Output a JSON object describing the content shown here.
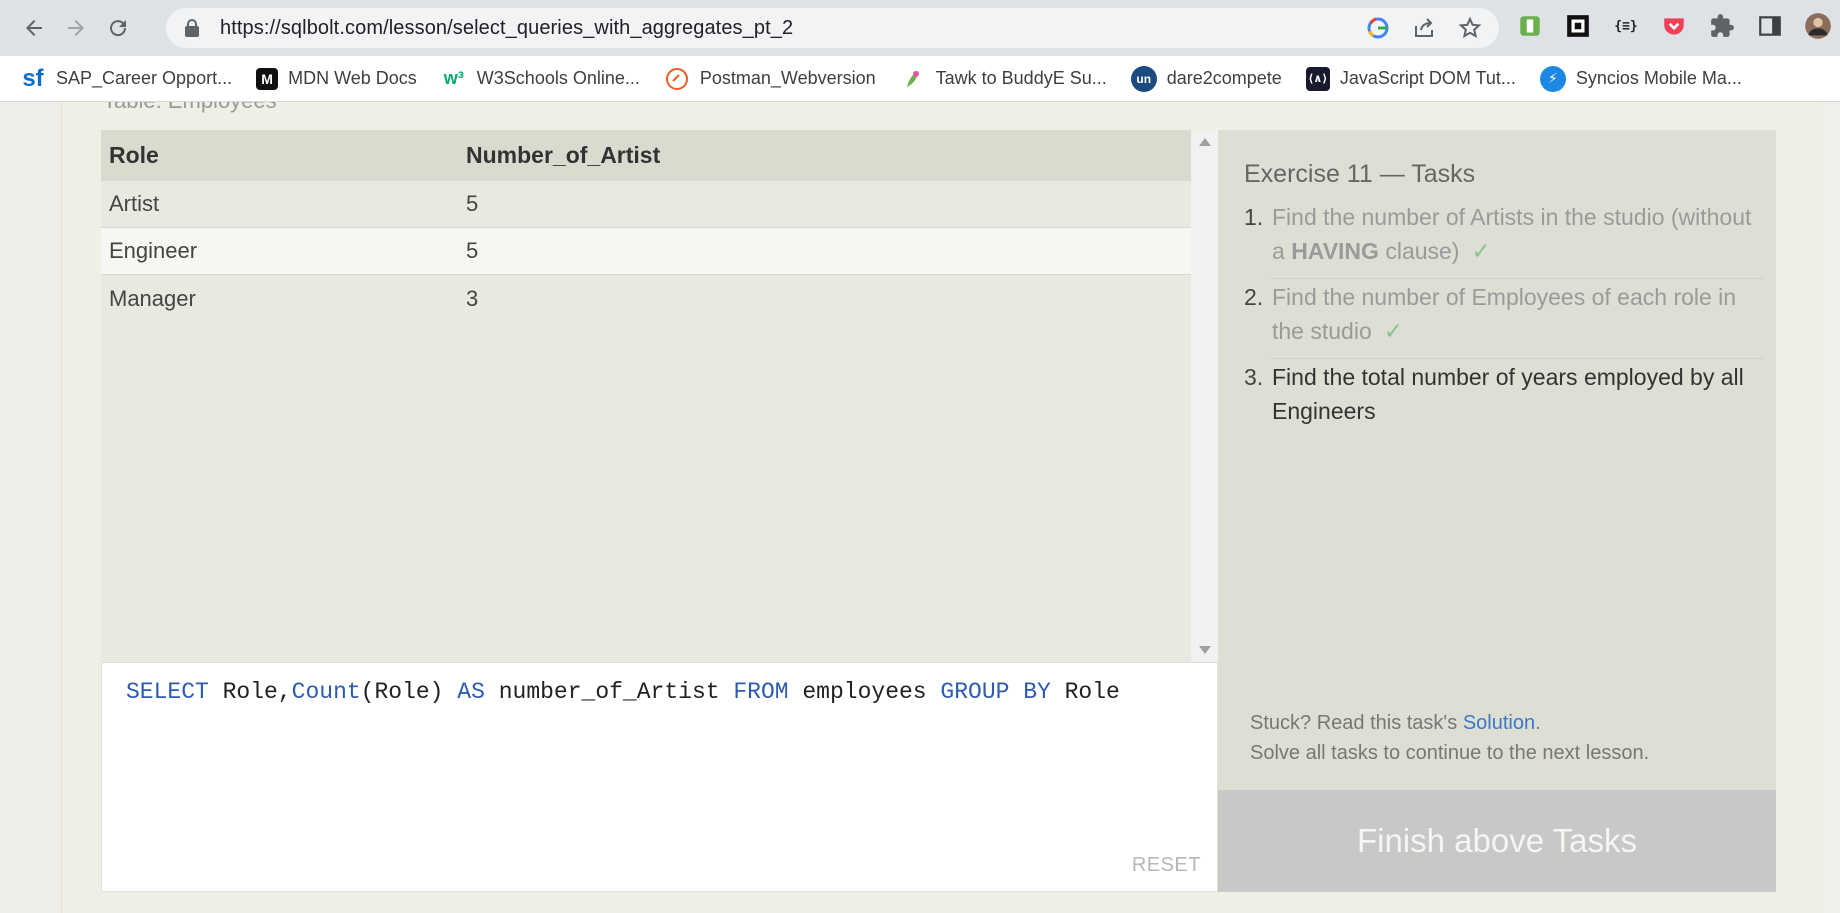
{
  "browser": {
    "url": "https://sqlbolt.com/lesson/select_queries_with_aggregates_pt_2",
    "bookmarks": [
      {
        "label": "SAP_Career Opport...",
        "icon": "sap-successfactors-icon"
      },
      {
        "label": "MDN Web Docs",
        "icon": "mdn-icon"
      },
      {
        "label": "W3Schools Online...",
        "icon": "w3schools-icon"
      },
      {
        "label": "Postman_Webversion",
        "icon": "postman-icon"
      },
      {
        "label": "Tawk to BuddyE Su...",
        "icon": "tawk-icon"
      },
      {
        "label": "dare2compete",
        "icon": "unstop-icon"
      },
      {
        "label": "JavaScript DOM Tut...",
        "icon": "javascript-dom-icon"
      },
      {
        "label": "Syncios Mobile Ma...",
        "icon": "syncios-icon"
      }
    ]
  },
  "lesson": {
    "table_label": "Table: Employees",
    "result_table": {
      "headers": [
        "Role",
        "Number_of_Artist"
      ],
      "rows": [
        [
          "Artist",
          "5"
        ],
        [
          "Engineer",
          "5"
        ],
        [
          "Manager",
          "3"
        ]
      ]
    },
    "query": {
      "kw_select": "SELECT",
      "t1": " Role,",
      "kw_count": "Count",
      "t2": "(Role) ",
      "kw_as": "AS",
      "t3": " number_of_Artist ",
      "kw_from": "FROM",
      "t4": " employees ",
      "kw_group": "GROUP BY",
      "t5": " Role"
    },
    "reset_label": "RESET",
    "tasks": {
      "title": "Exercise 11 — Tasks",
      "items": [
        {
          "num": "1.",
          "text_a": "Find the number of Artists in the studio (without a ",
          "bold": "HAVING",
          "text_b": " clause)",
          "done": true
        },
        {
          "num": "2.",
          "text_a": "Find the number of Employees of each role in the studio",
          "done": true
        },
        {
          "num": "3.",
          "text_a": "Find the total number of years employed by all Engineers",
          "done": false
        }
      ],
      "check_mark": "✓",
      "stuck_prefix": "Stuck? Read this task's ",
      "solution_label": "Solution",
      "stuck_suffix": ".",
      "continue_text": "Solve all tasks to continue to the next lesson.",
      "finish_label": "Finish above Tasks"
    }
  }
}
